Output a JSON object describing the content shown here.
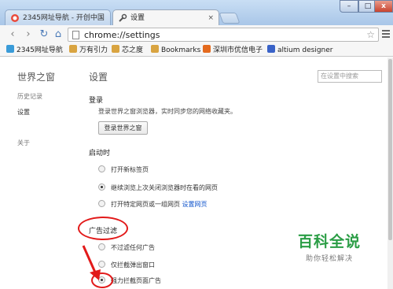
{
  "tabs": [
    {
      "label": "2345网址导航 - 开创中国",
      "close": "×"
    },
    {
      "label": "设置",
      "close": "×"
    }
  ],
  "window_controls": {
    "minimize": "–",
    "maximize": "□",
    "close": "x"
  },
  "toolbar": {
    "back": "‹",
    "forward": "›",
    "reload": "↻",
    "home": "⌂",
    "url": "chrome://settings",
    "star": "☆"
  },
  "bookmarks": [
    {
      "label": "2345网址导航",
      "color": "#3a9bd8"
    },
    {
      "label": "万有引力",
      "color": "#d9a441"
    },
    {
      "label": "芯之度",
      "color": "#d9a441"
    },
    {
      "label": "Bookmarks",
      "color": "#d9a441"
    },
    {
      "label": "深圳市优信电子",
      "color": "#e46a1e"
    },
    {
      "label": "altium designer",
      "color": "#3a63c8"
    }
  ],
  "sidebar": {
    "title": "世界之窗",
    "items": [
      {
        "label": "历史记录"
      },
      {
        "label": "设置"
      },
      {
        "label": "关于"
      }
    ]
  },
  "main": {
    "title": "设置",
    "search_placeholder": "在设置中搜索",
    "login": {
      "title": "登录",
      "description": "登录世界之窗浏览器，实时同步您的网络收藏夹。",
      "button": "登录世界之窗"
    },
    "startup": {
      "title": "启动时",
      "options": [
        {
          "label": "打开新标签页",
          "checked": false
        },
        {
          "label": "继续浏览上次关闭浏览器时在看的网页",
          "checked": true
        },
        {
          "label": "打开特定网页或一组网页",
          "link": "设置网页",
          "checked": false
        }
      ]
    },
    "adblock": {
      "title": "广告过滤",
      "options": [
        {
          "label": "不过滤任何广告",
          "checked": false
        },
        {
          "label": "仅拦截弹出窗口",
          "checked": false
        },
        {
          "label": "强力拦截页面广告",
          "checked": true
        }
      ]
    }
  },
  "watermark": {
    "main": "百科全说",
    "sub": "助你轻松解决"
  },
  "colors": {
    "annotation": "#e21a1a",
    "link": "#1155cc",
    "watermark": "#2a9d45"
  }
}
